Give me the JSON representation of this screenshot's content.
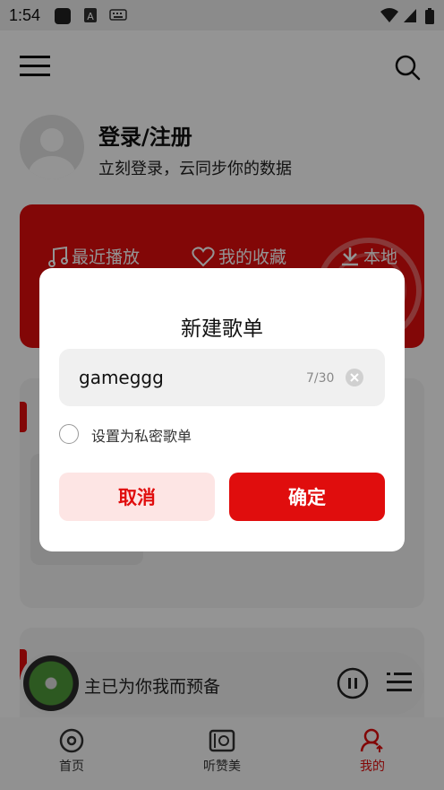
{
  "status_bar": {
    "time": "1:54"
  },
  "user": {
    "title": "登录/注册",
    "subtitle": "立刻登录，云同步你的数据"
  },
  "quick_actions": [
    {
      "label": "最近播放",
      "icon": "music-note-icon"
    },
    {
      "label": "我的收藏",
      "icon": "heart-icon"
    },
    {
      "label": "本地",
      "icon": "download-icon"
    }
  ],
  "player": {
    "song": "主已为你我而预备"
  },
  "nav": [
    {
      "label": "首页",
      "icon": "disc-icon"
    },
    {
      "label": "听赞美",
      "icon": "video-icon"
    },
    {
      "label": "我的",
      "icon": "user-icon",
      "active": true
    }
  ],
  "dialog": {
    "title": "新建歌单",
    "input_value": "gameggg",
    "counter": "7/30",
    "private_label": "设置为私密歌单",
    "cancel": "取消",
    "confirm": "确定"
  },
  "colors": {
    "accent": "#e00d0d",
    "cancel_bg": "#fde5e4"
  }
}
